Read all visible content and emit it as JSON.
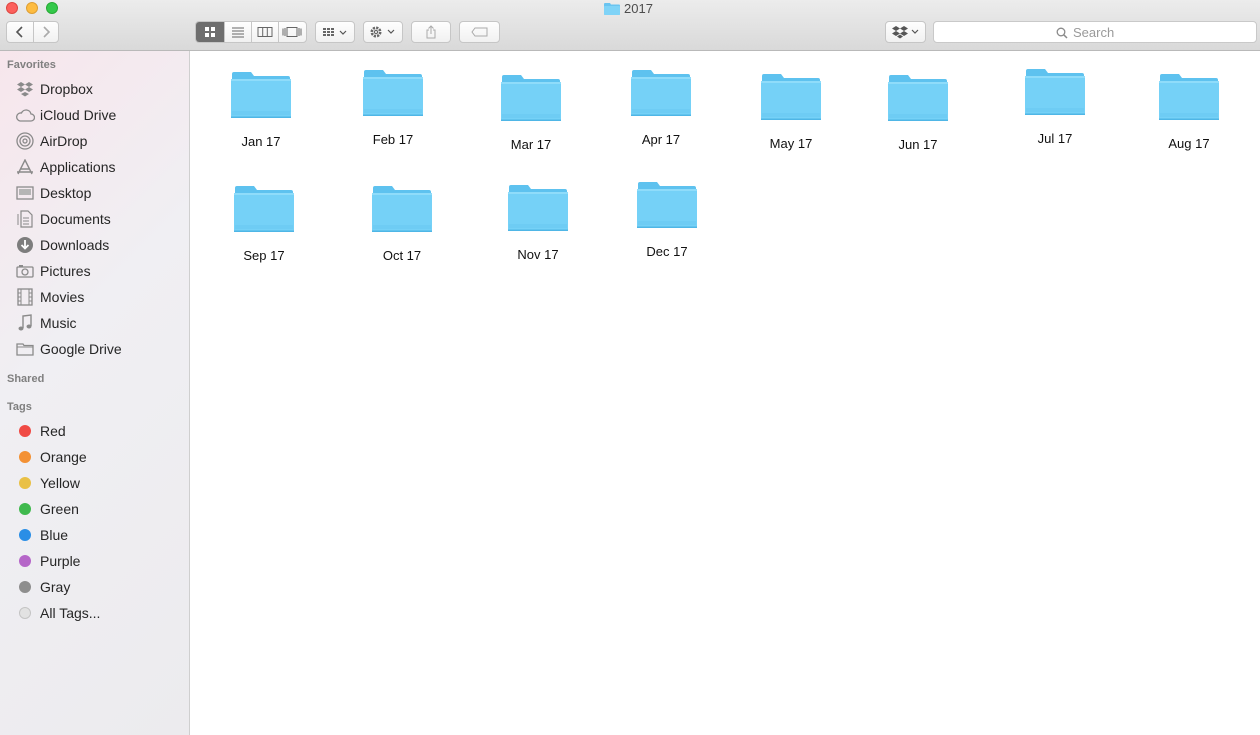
{
  "window": {
    "title": "2017"
  },
  "toolbar": {
    "view_modes": [
      "icon-view",
      "list-view",
      "column-view",
      "cover-flow-view"
    ],
    "active_view": "icon-view"
  },
  "search": {
    "placeholder": "Search"
  },
  "sidebar": {
    "favorites_title": "Favorites",
    "favorites": [
      {
        "label": "Dropbox",
        "icon": "dropbox-icon"
      },
      {
        "label": "iCloud Drive",
        "icon": "cloud-icon"
      },
      {
        "label": "AirDrop",
        "icon": "airdrop-icon"
      },
      {
        "label": "Applications",
        "icon": "applications-icon"
      },
      {
        "label": "Desktop",
        "icon": "desktop-icon"
      },
      {
        "label": "Documents",
        "icon": "documents-icon"
      },
      {
        "label": "Downloads",
        "icon": "downloads-icon"
      },
      {
        "label": "Pictures",
        "icon": "camera-icon"
      },
      {
        "label": "Movies",
        "icon": "film-icon"
      },
      {
        "label": "Music",
        "icon": "music-note-icon"
      },
      {
        "label": "Google Drive",
        "icon": "folder-icon"
      }
    ],
    "shared_title": "Shared",
    "tags_title": "Tags",
    "tags": [
      {
        "label": "Red",
        "color": "#f04a44"
      },
      {
        "label": "Orange",
        "color": "#f39134"
      },
      {
        "label": "Yellow",
        "color": "#e9c045"
      },
      {
        "label": "Green",
        "color": "#3fb94e"
      },
      {
        "label": "Blue",
        "color": "#2a8ee6"
      },
      {
        "label": "Purple",
        "color": "#b566c8"
      },
      {
        "label": "Gray",
        "color": "#8e8e8e"
      },
      {
        "label": "All Tags...",
        "color": "#e2e2e2"
      }
    ]
  },
  "content": {
    "folders": [
      "Jan 17",
      "Feb 17",
      "Mar 17",
      "Apr 17",
      "May 17",
      "Jun 17",
      "Jul 17",
      "Aug 17",
      "Sep 17",
      "Oct 17",
      "Nov 17",
      "Dec 17"
    ]
  },
  "colors": {
    "folder_blue": "#6dcdf5",
    "folder_tab": "#5fc1ee",
    "active_segment": "#6e6e6e"
  }
}
